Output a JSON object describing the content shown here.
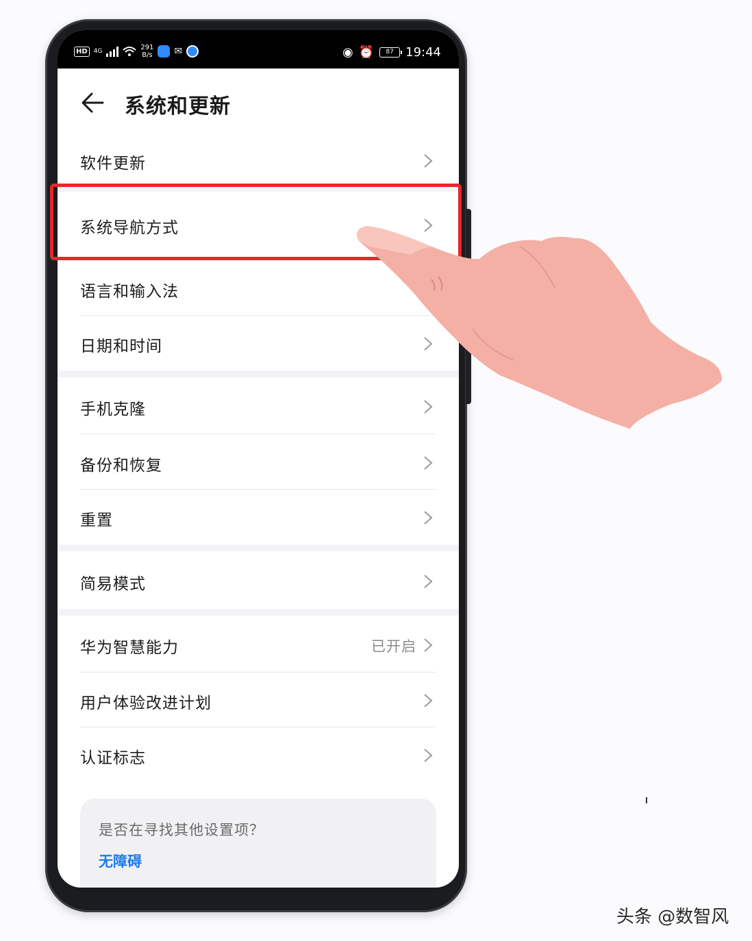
{
  "status_bar": {
    "hd": "HD",
    "network": "4G",
    "speed_value": "291",
    "speed_unit": "B/s",
    "battery": "87",
    "time": "19:44"
  },
  "header": {
    "title": "系统和更新"
  },
  "menu": [
    {
      "label": "软件更新"
    },
    {
      "label": "系统导航方式"
    },
    {
      "label": "语言和输入法"
    },
    {
      "label": "日期和时间"
    },
    {
      "label": "手机克隆"
    },
    {
      "label": "备份和恢复"
    },
    {
      "label": "重置"
    },
    {
      "label": "简易模式"
    },
    {
      "label": "华为智慧能力",
      "value": "已开启"
    },
    {
      "label": "用户体验改进计划"
    },
    {
      "label": "认证标志"
    }
  ],
  "suggestion_card": {
    "question": "是否在寻找其他设置项？",
    "link": "无障碍"
  },
  "watermark": "头条 @数智风",
  "colors": {
    "highlight": "#e8262b",
    "link": "#1d7ce8",
    "hand": "#f4b0a5"
  }
}
